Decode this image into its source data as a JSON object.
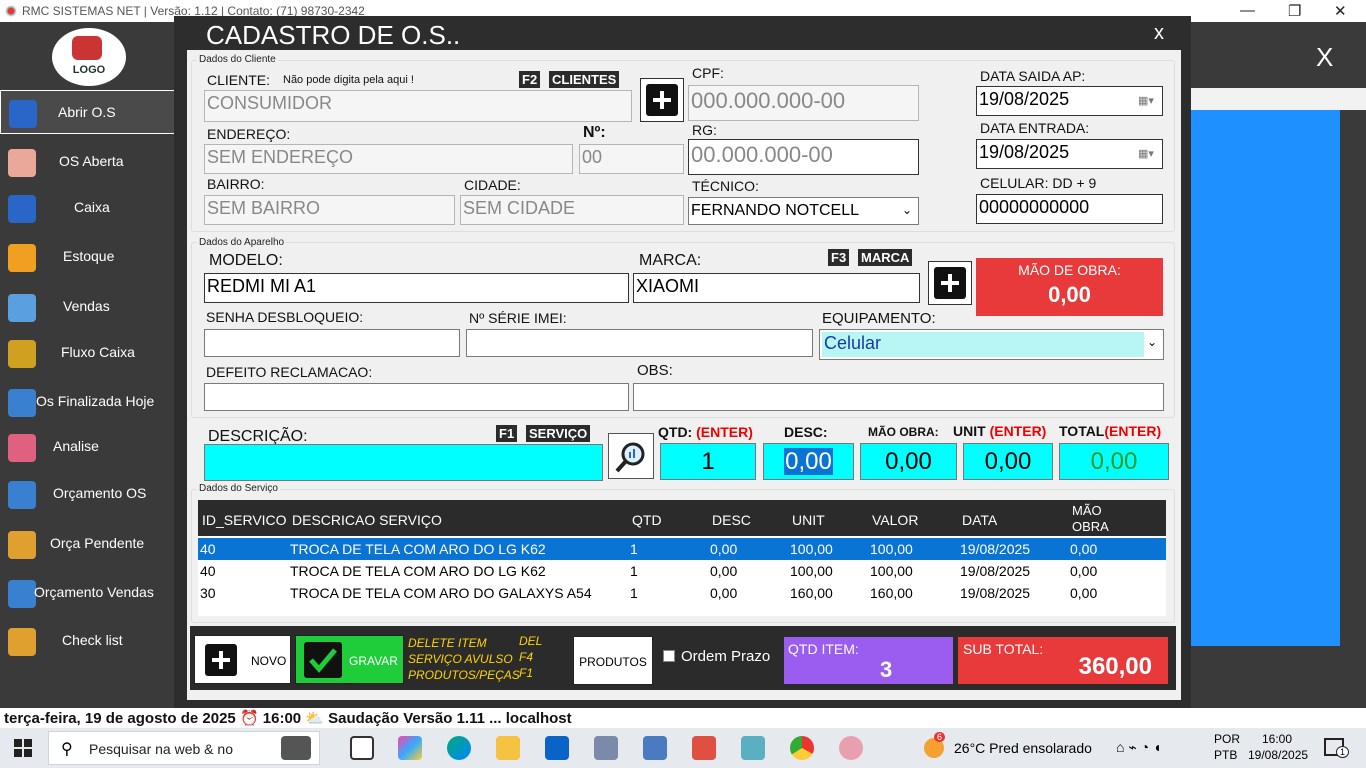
{
  "titlebar": {
    "text": "RMC SISTEMAS NET | Versão: 1.12 | Contato: (71) 98730-2342",
    "min": "—",
    "restore": "❐",
    "close": "✕"
  },
  "sidebar": {
    "logo": "LOGO",
    "items": [
      {
        "label": "Abrir O.S",
        "icon": "phone-icon",
        "color": "#2a66c8"
      },
      {
        "label": "OS Aberta",
        "icon": "hand-phone-icon",
        "color": "#e9a89a"
      },
      {
        "label": "Caixa",
        "icon": "cashier-icon",
        "color": "#2a66c8"
      },
      {
        "label": "Estoque",
        "icon": "box-icon",
        "color": "#f0a020"
      },
      {
        "label": "Vendas",
        "icon": "cart-icon",
        "color": "#5aa0e0"
      },
      {
        "label": "Fluxo Caixa",
        "icon": "money-icon",
        "color": "#d0a020"
      },
      {
        "label": "Os Finalizada Hoje",
        "icon": "phone-check-icon",
        "color": "#3a80d0"
      },
      {
        "label": "Analise",
        "icon": "analysis-icon",
        "color": "#e06080"
      },
      {
        "label": "Orçamento OS",
        "icon": "calculator-icon",
        "color": "#3a80d0"
      },
      {
        "label": "Orça Pendente",
        "icon": "clipboard-icon",
        "color": "#e0a030"
      },
      {
        "label": "Orçamento Vendas",
        "icon": "calculator-sheet-icon",
        "color": "#3a80d0"
      },
      {
        "label": "Check list",
        "icon": "checklist-icon",
        "color": "#e0a030"
      }
    ]
  },
  "bg": {
    "close": "X"
  },
  "modal": {
    "title": "CADASTRO DE O.S..",
    "close": "x"
  },
  "cliente": {
    "group": "Dados do Cliente",
    "cliente_label": "CLIENTE:",
    "cliente_hint": "Não pode digita pela aqui !",
    "f2": "F2",
    "clientes": "CLIENTES",
    "cliente_value": "CONSUMIDOR",
    "cpf_label": "CPF:",
    "cpf_value": "000.000.000-00",
    "endereco_label": "ENDEREÇO:",
    "endereco_value": "SEM ENDEREÇO",
    "numero_label": "Nº:",
    "numero_value": "00",
    "rg_label": "RG:",
    "rg_value": "00.000.000-00",
    "bairro_label": "BAIRRO:",
    "bairro_value": "SEM BAIRRO",
    "cidade_label": "CIDADE:",
    "cidade_value": "SEM CIDADE",
    "tecnico_label": "TÉCNICO:",
    "tecnico_value": "FERNANDO NOTCELL",
    "saida_label": "DATA SAIDA AP:",
    "saida_value": "19/08/2025",
    "entrada_label": "DATA ENTRADA:",
    "entrada_value": "19/08/2025",
    "celular_label": "CELULAR: DD + 9",
    "celular_value": "00000000000"
  },
  "aparelho": {
    "group": "Dados do Aparelho",
    "modelo_label": "MODELO:",
    "modelo_value": "REDMI MI A1",
    "marca_label": "MARCA:",
    "f3": "F3",
    "marca_tag": "MARCA",
    "marca_value": "XIAOMI",
    "mao_label": "MÃO DE OBRA:",
    "mao_value": "0,00",
    "senha_label": "SENHA DESBLOQUEIO:",
    "imei_label": "Nº SÉRIE IMEI:",
    "equip_label": "EQUIPAMENTO:",
    "equip_value": "Celular",
    "defeito_label": "DEFEITO RECLAMACAO:",
    "obs_label": "OBS:"
  },
  "servico": {
    "descricao_label": "DESCRIÇÃO:",
    "f1": "F1",
    "servico_tag": "SERVIÇO",
    "qtd_label": "QTD:",
    "enter": "(ENTER)",
    "desc_label": "DESC:",
    "mao_label": "MÃO OBRA:",
    "unit_label": "UNIT",
    "total_label": "TOTAL",
    "qtd_value": "1",
    "desc_value": "0,00",
    "mao_value": "0,00",
    "unit_value": "0,00",
    "total_value": "0,00"
  },
  "grid": {
    "group": "Dados do Serviço",
    "headers": [
      "ID_SERVICO",
      "DESCRICAO  SERVIÇO",
      "QTD",
      "DESC",
      "UNIT",
      "VALOR",
      "DATA",
      "MÃO",
      "OBRA"
    ],
    "rows": [
      [
        "40",
        "TROCA DE TELA COM ARO DO LG K62",
        "1",
        "0,00",
        "100,00",
        "100,00",
        "19/08/2025",
        "0,00"
      ],
      [
        "40",
        "TROCA DE TELA COM ARO DO LG K62",
        "1",
        "0,00",
        "100,00",
        "100,00",
        "19/08/2025",
        "0,00"
      ],
      [
        "30",
        "TROCA DE TELA COM ARO DO GALAXYS A54",
        "1",
        "0,00",
        "160,00",
        "160,00",
        "19/08/2025",
        "0,00"
      ]
    ]
  },
  "bottom": {
    "novo": "NOVO",
    "gravar": "GRAVAR",
    "hint1": "DELETE ITEM",
    "hint2": "SERVIÇO AVULSO",
    "hint3": "PRODUTOS/PEÇAS",
    "key1": "DEL",
    "key2": "F4",
    "key3": "F1",
    "produtos": "PRODUTOS",
    "prazo": "Ordem Prazo",
    "qtd_item_label": "QTD ITEM:",
    "qtd_item_value": "3",
    "subtotal_label": "SUB TOTAL:",
    "subtotal_value": "360,00"
  },
  "statusline": "terça-feira, 19 de agosto de 2025 ⏰ 16:00 ⛅ Saudação  Versão 1.11  ...  localhost",
  "taskbar": {
    "search": "Pesquisar na web & no",
    "weather": "26°C  Pred ensolarado",
    "weather_badge": "6",
    "lang1": "POR",
    "lang2": "PTB",
    "time": "16:00",
    "date": "19/08/2025",
    "notif": "1"
  }
}
